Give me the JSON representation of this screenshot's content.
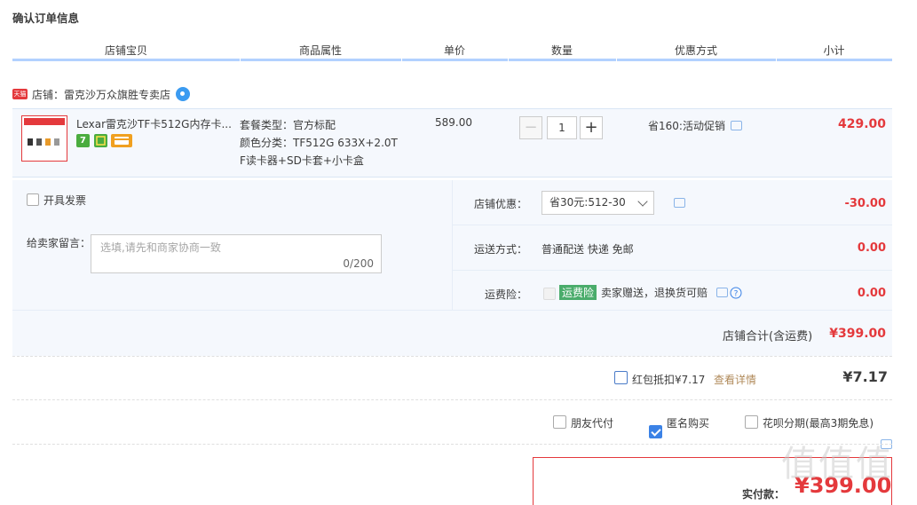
{
  "page": {
    "title": "确认订单信息"
  },
  "columns": [
    "店铺宝贝",
    "商品属性",
    "单价",
    "数量",
    "优惠方式",
    "小计"
  ],
  "shop": {
    "badge": "天猫",
    "label": "店铺：雷克沙万众旗胜专卖店"
  },
  "item": {
    "name": "Lexar雷克沙TF卡512G内存卡...",
    "badges": [
      "7",
      "",
      ""
    ],
    "props": [
      "套餐类型：官方标配",
      "颜色分类：TF512G 633X+2.0T",
      "F读卡器+SD卡套+小卡盒"
    ],
    "unit_price": "589.00",
    "quantity": "1",
    "qty_minus": "−",
    "qty_plus": "+",
    "promo": "省160:活动促销",
    "subtotal": "429.00"
  },
  "invoice": {
    "label": "开具发票"
  },
  "message": {
    "label": "给卖家留言：",
    "placeholder": "选填,请先和商家协商一致",
    "count": "0/200"
  },
  "shop_discount": {
    "label": "店铺优惠：",
    "selected": "省30元:512-30",
    "amount": "-30.00"
  },
  "shipping": {
    "label": "运送方式：",
    "value": "普通配送 快递 免邮",
    "amount": "0.00"
  },
  "freight_insurance": {
    "label": "运费险：",
    "tag": "运费险",
    "desc": "卖家赠送，退换货可赔",
    "amount": "0.00"
  },
  "shop_total": {
    "label": "店铺合计(含运费)",
    "amount": "¥399.00"
  },
  "redpacket": {
    "label": "红包抵扣¥7.17",
    "link": "查看详情",
    "amount": "¥7.17"
  },
  "options": {
    "friend_pay": "朋友代付",
    "anonymous": "匿名购买",
    "huabei": "花呗分期(最高3期免息)"
  },
  "payment": {
    "label": "实付款：",
    "amount": "¥399.00"
  },
  "watermark": "值值值"
}
